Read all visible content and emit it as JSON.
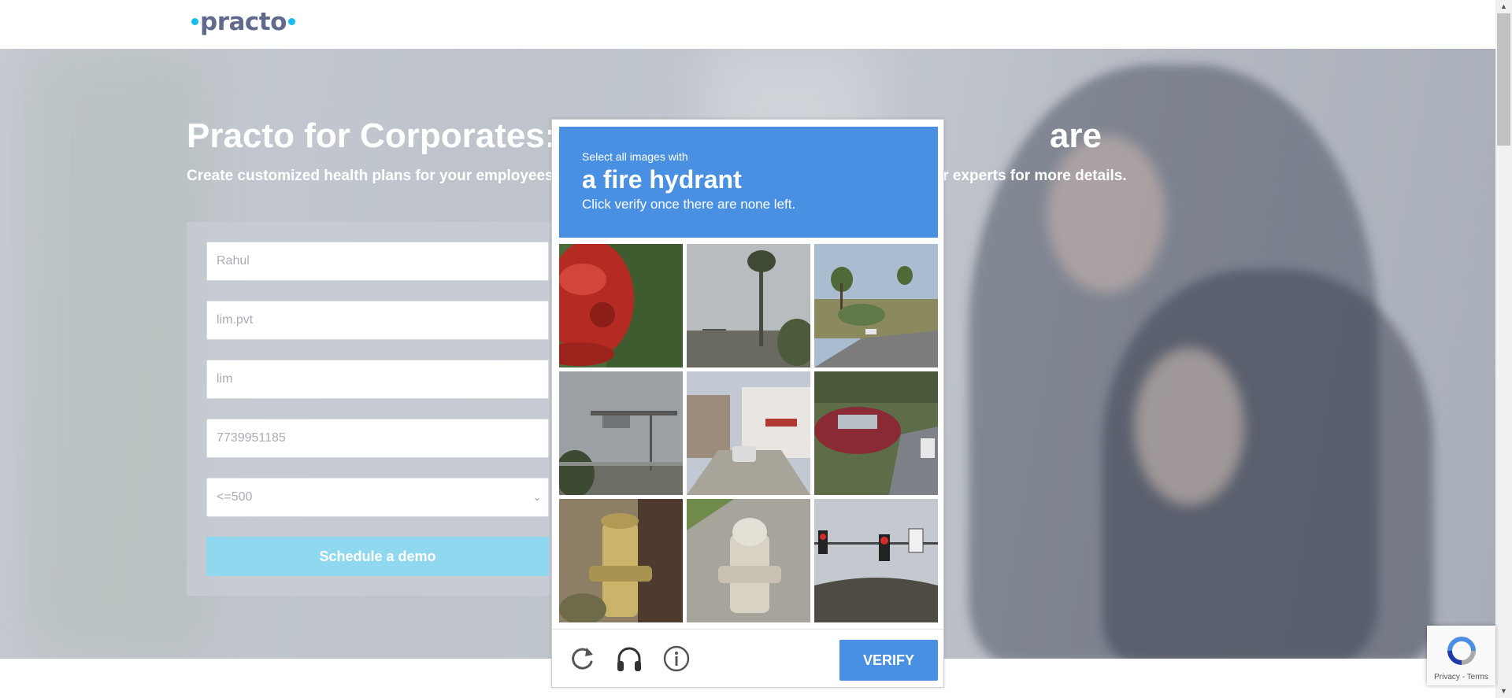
{
  "header": {
    "logo_text": "practo"
  },
  "hero": {
    "title": "Practo for Corporates: O",
    "title_tail": "are",
    "subtitle": "Create customized health plans for your employees",
    "subtitle_tail": "ur experts for more details."
  },
  "form": {
    "name_value": "Rahul",
    "company_value": "lim.pvt",
    "designation_value": "lim",
    "phone_value": "7739951185",
    "size_selected": "<=500",
    "cta_label": "Schedule a demo"
  },
  "captcha": {
    "instruction_small": "Select all images with",
    "target_object": "a fire hydrant",
    "instruction_more": "Click verify once there are none left.",
    "tiles": [
      {
        "name": "captcha-tile-1",
        "icon": "fire-hydrant-closeup-red"
      },
      {
        "name": "captcha-tile-2",
        "icon": "palm-tree"
      },
      {
        "name": "captcha-tile-3",
        "icon": "road-with-trees"
      },
      {
        "name": "captcha-tile-4",
        "icon": "highway-sign"
      },
      {
        "name": "captcha-tile-5",
        "icon": "street-with-house"
      },
      {
        "name": "captcha-tile-6",
        "icon": "parked-cars"
      },
      {
        "name": "captcha-tile-7",
        "icon": "fire-hydrant-yellow"
      },
      {
        "name": "captcha-tile-8",
        "icon": "fire-hydrant-white"
      },
      {
        "name": "captcha-tile-9",
        "icon": "traffic-light"
      }
    ],
    "reload_icon": "reload-icon",
    "audio_icon": "headphones-icon",
    "info_icon": "info-icon",
    "verify_label": "VERIFY"
  },
  "recaptcha_badge": {
    "text": "Privacy - Terms"
  },
  "colors": {
    "captcha_blue": "#4a90e2",
    "cta_color": "#8fd8f0",
    "logo_color": "#5f6a8c",
    "logo_dot": "#14bef0"
  }
}
